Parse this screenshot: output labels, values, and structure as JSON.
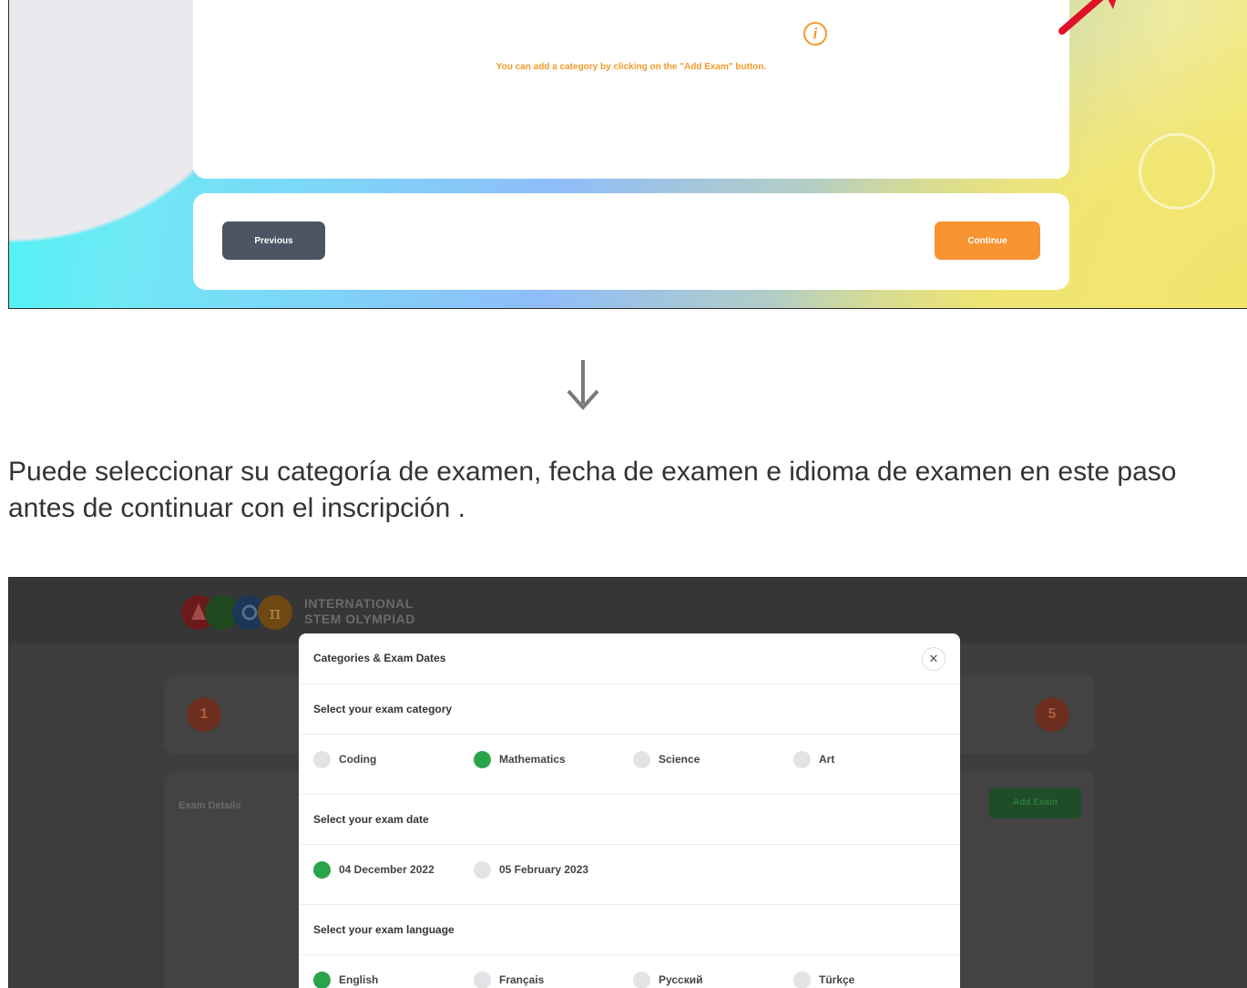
{
  "top_screen": {
    "info_message": "You can add a category by clicking on the \"Add Exam\" button.",
    "previous_label": "Previous",
    "continue_label": "Continue"
  },
  "caption": "Puede seleccionar su categoría de examen, fecha de examen e idioma de examen en este paso antes de continuar con el inscripción .",
  "bottom_screen": {
    "brand_line1": "INTERNATIONAL",
    "brand_line2": "STEM OLYMPIAD",
    "step_first": "1",
    "step_last": "5",
    "exam_details_label": "Exam Details",
    "add_exam_label": "Add Exam",
    "modal": {
      "title": "Categories & Exam Dates",
      "category_heading": "Select your exam category",
      "categories": [
        {
          "label": "Coding",
          "selected": false
        },
        {
          "label": "Mathematics",
          "selected": true
        },
        {
          "label": "Science",
          "selected": false
        },
        {
          "label": "Art",
          "selected": false
        }
      ],
      "date_heading": "Select your exam date",
      "dates": [
        {
          "label": "04 December 2022",
          "selected": true
        },
        {
          "label": "05 February 2023",
          "selected": false
        }
      ],
      "language_heading": "Select your exam language",
      "languages": [
        {
          "label": "English",
          "selected": true
        },
        {
          "label": "Français",
          "selected": false
        },
        {
          "label": "Русский",
          "selected": false
        },
        {
          "label": "Türkçe",
          "selected": false
        }
      ]
    }
  },
  "colors": {
    "orange": "#f79331",
    "dark_button": "#4c5563",
    "selected_radio": "#2aa44a",
    "unselected_radio": "#e3e3e7"
  }
}
